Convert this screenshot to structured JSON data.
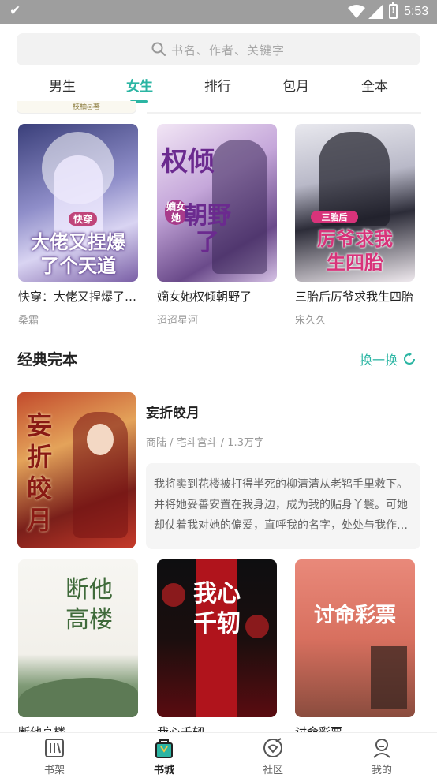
{
  "status_bar": {
    "time": "5:53",
    "battery_label": "!"
  },
  "search": {
    "placeholder": "书名、作者、关键字"
  },
  "tabs": [
    {
      "label": "男生",
      "active": false
    },
    {
      "label": "女生",
      "active": true
    },
    {
      "label": "排行",
      "active": false
    },
    {
      "label": "包月",
      "active": false
    },
    {
      "label": "全本",
      "active": false
    }
  ],
  "partial_row": {
    "publisher_text": "枝柚◎著"
  },
  "book_row_1": [
    {
      "title": "快穿：大佬又捏爆了个天道",
      "author": "桑霜",
      "cover_lines": [
        "快穿",
        "大佬又捏爆",
        "了个天道"
      ]
    },
    {
      "title": "嫡女她权倾朝野了",
      "author": "迢迢星河",
      "cover_lines": [
        "权倾",
        "嫡女她",
        "朝野了"
      ]
    },
    {
      "title": "三胎后厉爷求我生四胎",
      "author": "宋久久",
      "cover_lines": [
        "三胎后",
        "厉爷求我",
        "生四胎"
      ]
    }
  ],
  "classics": {
    "section_title": "经典完本",
    "refresh_label": "换一换",
    "featured": {
      "title": "妄折皎月",
      "meta": "商陆 / 宅斗宫斗 / 1.3万字",
      "description": "我将卖到花楼被打得半死的柳清清从老鸨手里救下。并将她妥善安置在我身边，成为我的贴身丫鬟。可她却仗着我对她的偏爱，直呼我的名字，处处与我作对。",
      "cover_text": "妄折皎月"
    },
    "books": [
      {
        "title": "断他高楼",
        "cover_text": "断他高楼"
      },
      {
        "title": "我心千轫",
        "cover_text": "我心千轫"
      },
      {
        "title": "讨命彩票",
        "cover_text": "讨命彩票"
      }
    ]
  },
  "bottom_nav": [
    {
      "label": "书架",
      "icon": "bookshelf-icon",
      "active": false
    },
    {
      "label": "书城",
      "icon": "bookstore-icon",
      "active": true
    },
    {
      "label": "社区",
      "icon": "community-icon",
      "active": false
    },
    {
      "label": "我的",
      "icon": "profile-icon",
      "active": false
    }
  ],
  "colors": {
    "accent": "#2bb5a3",
    "status_bar": "#9e9e9e",
    "muted_text": "#999999"
  }
}
